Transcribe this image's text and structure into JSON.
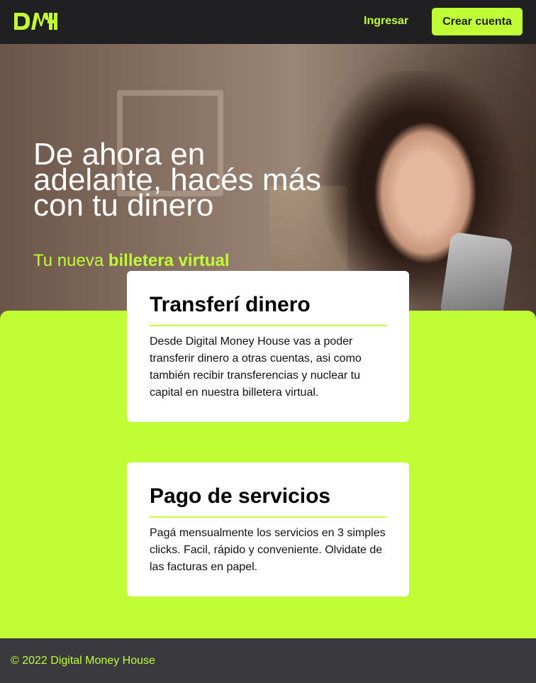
{
  "header": {
    "logo_text": "DMH",
    "login_label": "Ingresar",
    "signup_label": "Crear cuenta"
  },
  "hero": {
    "title": "De ahora en adelante, hacés más con tu dinero",
    "subtitle_prefix": "Tu nueva ",
    "subtitle_bold": "billetera virtual",
    "image_alt": "woman-with-phone"
  },
  "cards": [
    {
      "title": "Transferí dinero",
      "text": "Desde Digital Money House vas a poder transferir dinero a otras cuentas, asi como también recibir transferencias y nuclear tu capital en nuestra billetera virtual."
    },
    {
      "title": "Pago de servicios",
      "text": "Pagá mensualmente los servicios en 3 simples clicks. Facil, rápido y conveniente. Olvidate de las facturas en papel."
    }
  ],
  "footer": {
    "copyright": "© 2022 Digital Money House"
  },
  "colors": {
    "accent": "#c1fd35",
    "dark": "#201f22",
    "footer_bg": "#3a393e"
  }
}
